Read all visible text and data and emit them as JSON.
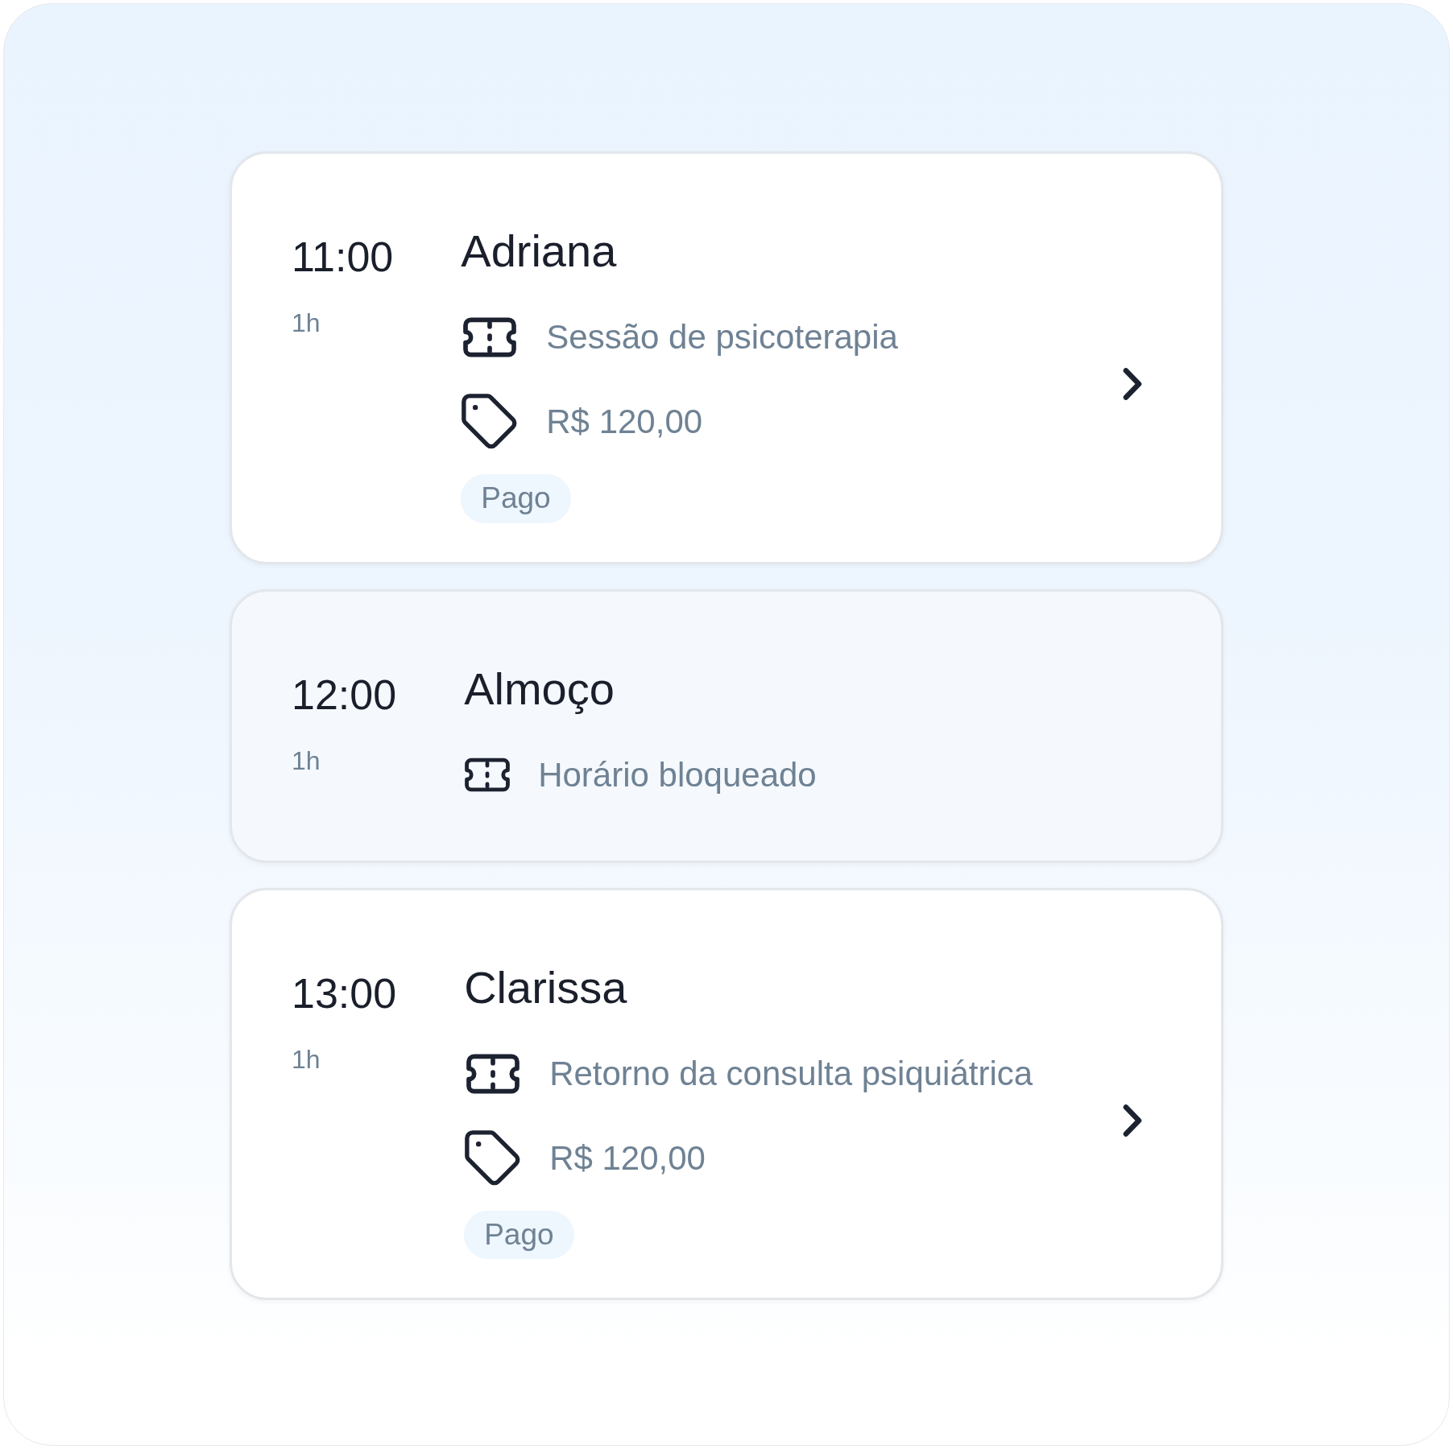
{
  "appointments": [
    {
      "kind": "appointment",
      "time": "11:00",
      "duration": "1h",
      "title": "Adriana",
      "details": [
        {
          "kind": "service",
          "text": "Sessão de psicoterapia"
        },
        {
          "kind": "price",
          "text": "R$ 120,00"
        }
      ],
      "status": "Pago",
      "openable": true
    },
    {
      "kind": "blocked",
      "time": "12:00",
      "duration": "1h",
      "title": "Almoço",
      "details": [
        {
          "kind": "service",
          "text": "Horário bloqueado"
        }
      ],
      "openable": false
    },
    {
      "kind": "appointment",
      "time": "13:00",
      "duration": "1h",
      "title": "Clarissa",
      "details": [
        {
          "kind": "service",
          "text": "Retorno da consulta psiquiátrica"
        },
        {
          "kind": "price",
          "text": "R$ 120,00"
        }
      ],
      "status": "Pago",
      "openable": true
    }
  ]
}
